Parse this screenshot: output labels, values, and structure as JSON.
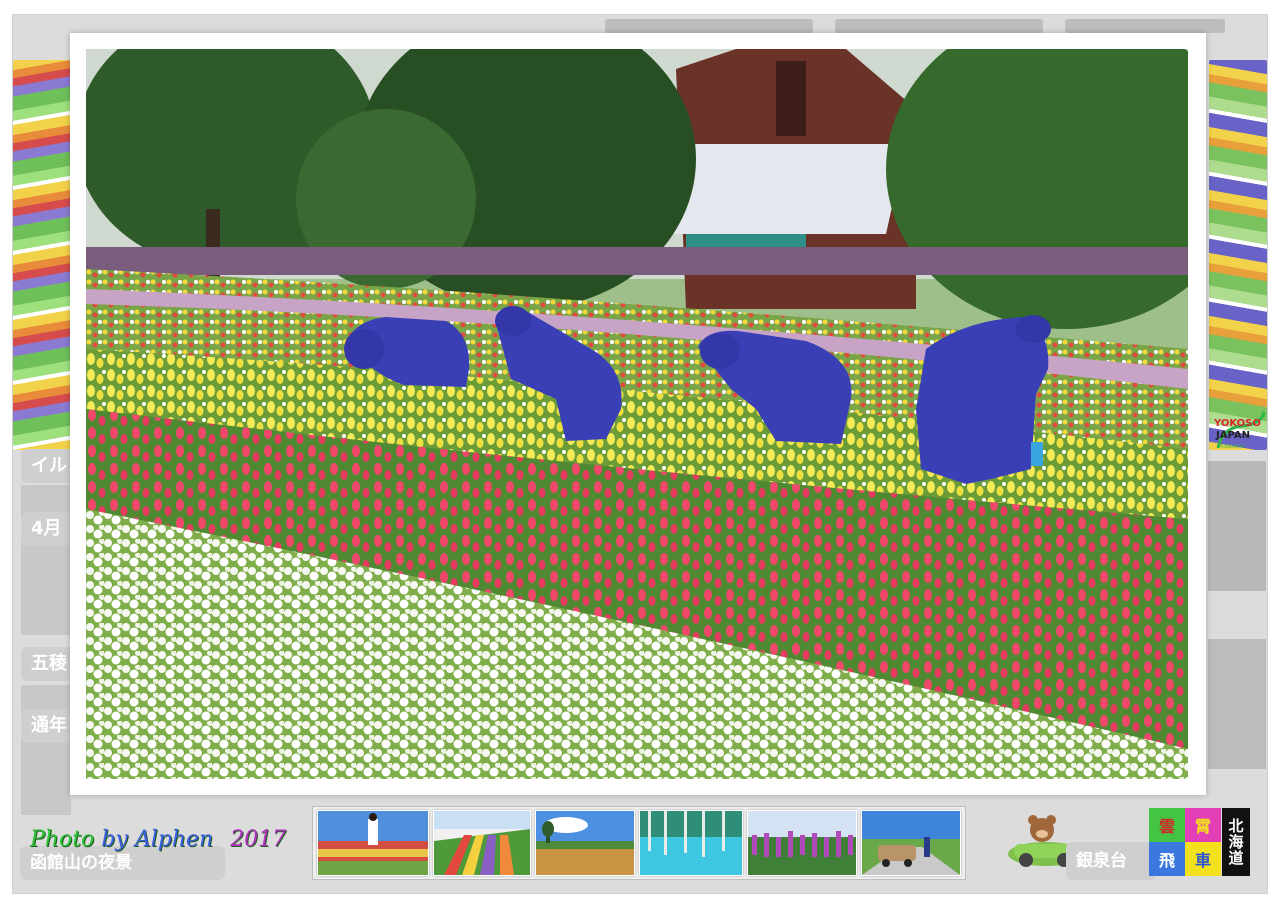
{
  "background_page": {
    "labels": {
      "row1": "イル",
      "row2": "4月",
      "row3": "五稜",
      "row4": "通年"
    },
    "caption_left": "函館山の夜景",
    "caption_right": "銀泉台"
  },
  "lightbox": {
    "photo_alt": "Workers in blue rain gear tending rows of snapdragons and white flowers in front of a wooden building",
    "credit_photo": "Photo",
    "credit_by": "by Alphen",
    "credit_year": "2017"
  },
  "thumbnails": [
    {
      "name": "person-in-flower-field"
    },
    {
      "name": "striped-flower-hills"
    },
    {
      "name": "wheat-field-blue-sky"
    },
    {
      "name": "blue-pond-trees"
    },
    {
      "name": "purple-lupine-field"
    },
    {
      "name": "car-on-country-road"
    }
  ],
  "logos": {
    "yokoso_top": "YOKOSO",
    "yokoso_bottom": "JAPAN",
    "yokoso_sub": "HOKKAIDO",
    "grid": [
      "雲",
      "霄",
      "飛",
      "車"
    ],
    "hokkaido": "北海道",
    "grid_colors": [
      "#43c443",
      "#e23fb6",
      "#3a78e0",
      "#f2e11c"
    ]
  }
}
